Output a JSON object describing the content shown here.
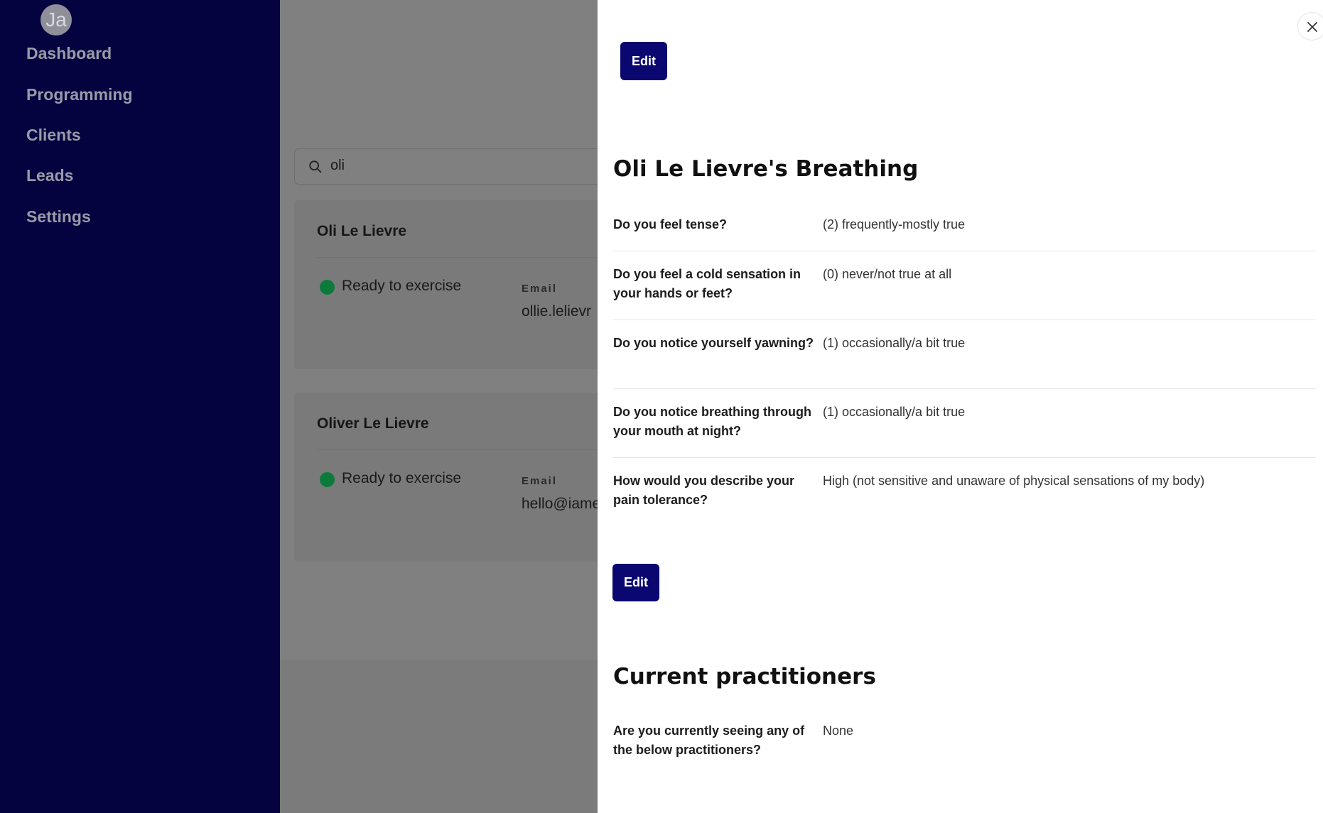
{
  "sidebar": {
    "avatar_initials": "Ja",
    "items": [
      {
        "label": "Dashboard"
      },
      {
        "label": "Programming"
      },
      {
        "label": "Clients"
      },
      {
        "label": "Leads"
      },
      {
        "label": "Settings"
      }
    ]
  },
  "search": {
    "value": "oli",
    "icon": "search-icon"
  },
  "clients": [
    {
      "name": "Oli Le Lievre",
      "status": "Ready to exercise",
      "email_label": "Email",
      "email": "ollie.lelievr"
    },
    {
      "name": "Oliver Le Lievre",
      "status": "Ready to exercise",
      "email_label": "Email",
      "email": "hello@iame"
    }
  ],
  "drawer": {
    "edit_top_label": "Edit",
    "breathing_title": "Oli Le Lievre's Breathing",
    "breathing_rows": [
      {
        "question": "Do you feel tense?",
        "answer": "(2) frequently-mostly true"
      },
      {
        "question": "Do you feel a cold sensation in your hands or feet?",
        "answer": "(0) never/not true at all"
      },
      {
        "question": "Do you notice yourself yawning?",
        "answer": "(1) occasionally/a bit true"
      },
      {
        "question": "Do you notice breathing through your mouth at night?",
        "answer": "(1) occasionally/a bit true"
      },
      {
        "question": "How would you describe your pain tolerance?",
        "answer": "High (not sensitive and unaware of physical sensations of my body)"
      }
    ],
    "edit_bottom_label": "Edit",
    "practitioners_title": "Current practitioners",
    "practitioners_rows": [
      {
        "question": "Are you currently seeing any of the below practitioners?",
        "answer": "None"
      }
    ]
  },
  "colors": {
    "sidebar_bg": "#04033f",
    "button_bg": "#0a0770",
    "status_green": "#0b7a3a"
  }
}
